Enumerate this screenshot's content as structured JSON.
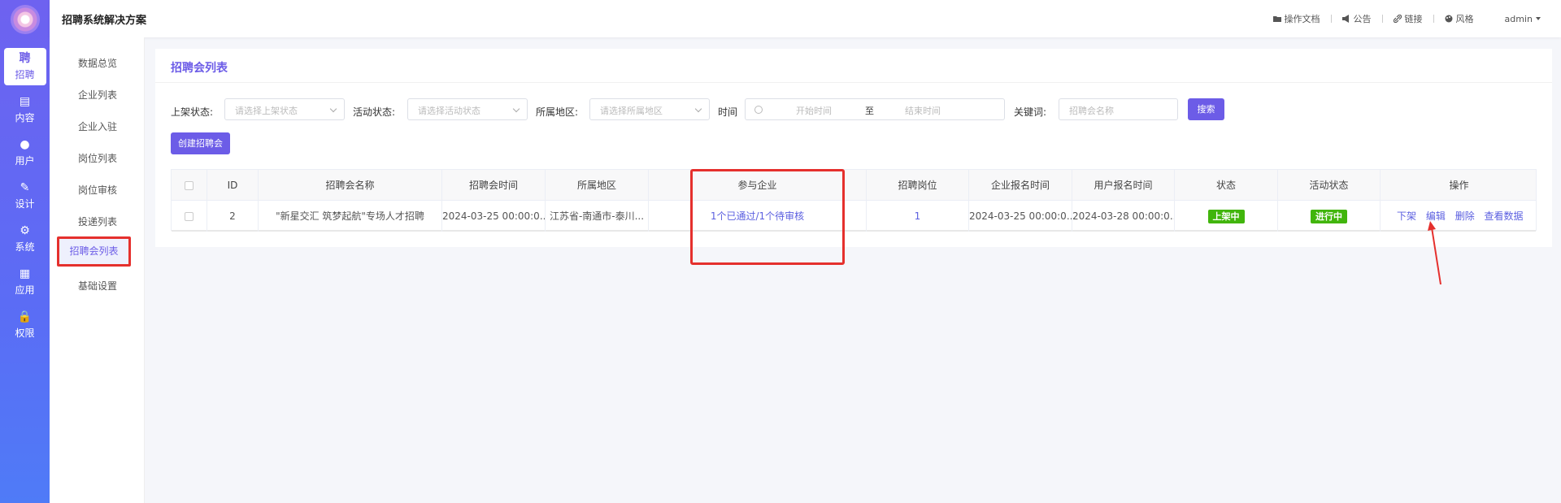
{
  "header": {
    "app_title": "招聘系统解决方案",
    "links": [
      {
        "icon": "folder-icon",
        "label": "操作文档"
      },
      {
        "icon": "megaphone-icon",
        "label": "公告"
      },
      {
        "icon": "link-icon",
        "label": "链接"
      },
      {
        "icon": "palette-icon",
        "label": "风格"
      }
    ],
    "user": "admin"
  },
  "rail": {
    "logo": "app-logo",
    "items": [
      {
        "icon_text": "聘",
        "label": "招聘",
        "active": true
      },
      {
        "icon_text": "▤",
        "label": "内容"
      },
      {
        "icon_text": "●",
        "label": "用户"
      },
      {
        "icon_text": "✎",
        "label": "设计"
      },
      {
        "icon_text": "⚙",
        "label": "系统"
      },
      {
        "icon_text": "▦",
        "label": "应用"
      },
      {
        "icon_text": "🔒",
        "label": "权限"
      }
    ]
  },
  "submenu": {
    "items": [
      "数据总览",
      "企业列表",
      "企业入驻",
      "岗位列表",
      "岗位审核",
      "投递列表",
      "招聘会列表",
      "基础设置"
    ],
    "active": "招聘会列表"
  },
  "main": {
    "title": "招聘会列表",
    "filters": {
      "shelf_status_label": "上架状态:",
      "shelf_status_placeholder": "请选择上架状态",
      "activity_status_label": "活动状态:",
      "activity_status_placeholder": "请选择活动状态",
      "region_label": "所属地区:",
      "region_placeholder": "请选择所属地区",
      "time_label": "时间",
      "start_placeholder": "开始时间",
      "range_sep": "至",
      "end_placeholder": "结束时间",
      "keyword_label": "关键词:",
      "keyword_placeholder": "招聘会名称",
      "search_label": "搜索"
    },
    "create_label": "创建招聘会",
    "table": {
      "columns": [
        "ID",
        "招聘会名称",
        "招聘会时间",
        "所属地区",
        "参与企业",
        "招聘岗位",
        "企业报名时间",
        "用户报名时间",
        "状态",
        "活动状态",
        "操作"
      ],
      "rows": [
        {
          "id": "2",
          "name": "\"新星交汇 筑梦起航\"专场人才招聘",
          "time": "2024-03-25 00:00:0...",
          "region": "江苏省-南通市-泰川...",
          "companies": "1个已通过/1个待审核",
          "positions": "1",
          "company_signup_time": "2024-03-25 00:00:0...",
          "user_signup_time": "2024-03-28 00:00:0...",
          "status": "上架中",
          "activity_status": "进行中",
          "actions": [
            "下架",
            "编辑",
            "删除",
            "查看数据"
          ]
        }
      ]
    }
  },
  "colors": {
    "accent": "#6c5ce7",
    "highlight": "#e5302d",
    "status_green": "#41b50c"
  }
}
